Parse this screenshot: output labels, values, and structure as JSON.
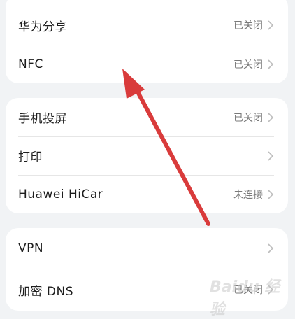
{
  "groups": [
    {
      "items": [
        {
          "label": "华为分享",
          "status": "已关闭"
        },
        {
          "label": "NFC",
          "status": "已关闭"
        }
      ]
    },
    {
      "items": [
        {
          "label": "手机投屏",
          "status": "已关闭"
        },
        {
          "label": "打印",
          "status": ""
        },
        {
          "label": "Huawei HiCar",
          "status": "未连接"
        }
      ]
    },
    {
      "items": [
        {
          "label": "VPN",
          "status": ""
        },
        {
          "label": "加密 DNS",
          "status": "已关闭"
        }
      ]
    }
  ],
  "icons": {
    "chevron": "chevron-right-icon",
    "annotation": "red-arrow-icon"
  },
  "colors": {
    "background": "#f1f3f5",
    "card": "#ffffff",
    "annotation_arrow": "#d93b3b"
  },
  "watermark": "Baidu 经验"
}
